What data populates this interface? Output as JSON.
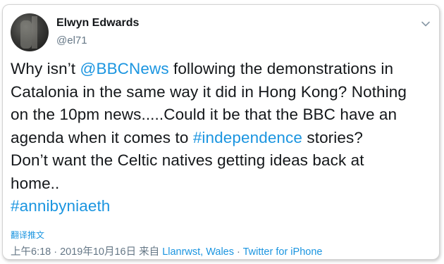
{
  "tweet": {
    "author_name": "Elwyn Edwards",
    "author_handle": "@el71",
    "avatar_icon": "profile-photo",
    "menu_icon": "chevron-down-icon",
    "body": {
      "l1_pre": "Why isn’t ",
      "l1_mention": "@BBCNews",
      "l1_post": " following the demonstrations in",
      "l2": "Catalonia in the same way it did in Hong Kong? Nothing",
      "l3": "on the 10pm news.....Could it be that the BBC have an",
      "l4_pre": "agenda when it comes to ",
      "l4_hashtag": "#independence",
      "l4_post": " stories?",
      "l5": "Don’t want the Celtic natives getting ideas back at",
      "l6": "home..",
      "l7_hashtag": "#annibyniaeth"
    },
    "translate_label": "翻译推文",
    "meta": {
      "time": "上午6:18 · 2019年10月16日 来自 ",
      "location": "Llanrwst, Wales",
      "separator": " · ",
      "source": "Twitter for iPhone"
    },
    "colors": {
      "text": "#14171a",
      "secondary": "#657786",
      "link": "#1b95e0"
    }
  }
}
